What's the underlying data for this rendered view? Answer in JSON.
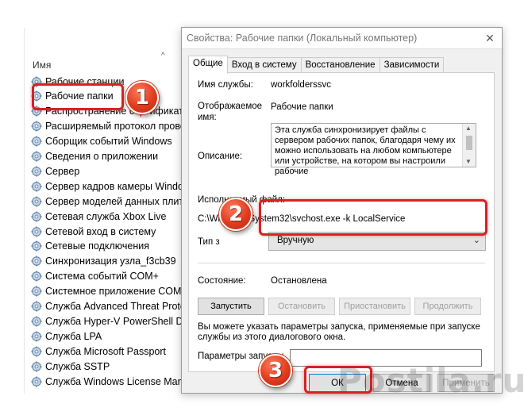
{
  "services_list": {
    "column_header": "Имя",
    "items": [
      "Рабочие станции",
      "Рабочие папки",
      "Распространение сертификата",
      "Расширяемый протокол прове",
      "Сборщик событий Windows",
      "Сведения о приложении",
      "Сервер",
      "Сервер кадров камеры Window",
      "Сервер моделей данных плитки",
      "Сетевая служба Xbox Live",
      "Сетевой вход в систему",
      "Сетевые подключения",
      "Синхронизация узла_f3cb39",
      "Система событий COM+",
      "Системное приложение COM+",
      "Служба Advanced Threat Protec",
      "Служба Hyper-V PowerShell Dire",
      "Служба LPA",
      "Служба Microsoft Passport",
      "Служба SSTP",
      "Служба Windows License Mana"
    ]
  },
  "dialog": {
    "title": "Свойства: Рабочие папки (Локальный компьютер)",
    "close_glyph": "✕",
    "tabs": [
      "Общие",
      "Вход в систему",
      "Восстановление",
      "Зависимости"
    ],
    "service_name_label": "Имя службы:",
    "service_name_value": "workfolderssvc",
    "display_name_label": "Отображаемое имя:",
    "display_name_value": "Рабочие папки",
    "description_label": "Описание:",
    "description_text": "Эта служба синхронизирует файлы с сервером рабочих папок, благодаря чему их можно использовать на любом компьютере или устройстве, на котором вы настроили рабочие",
    "exe_label": "Исполняемый файл:",
    "exe_value": "C:\\Windows\\System32\\svchost.exe -k LocalService",
    "startup_type_label": "Тип з",
    "startup_type_value": "Вручную",
    "status_label": "Состояние:",
    "status_value": "Остановлена",
    "buttons": {
      "start": "Запустить",
      "stop": "Остановить",
      "pause": "Приостановить",
      "resume": "Продолжить"
    },
    "hint_text": "Вы можете указать параметры запуска, применяемые при запуске службы из этого диалогового окна.",
    "params_label": "Параметры запуска:",
    "params_value": "",
    "ok_label": "ОК",
    "cancel_label": "Отмена",
    "apply_label": "Применить"
  },
  "annotations": {
    "badge_1": "1",
    "badge_2": "2",
    "badge_3": "3",
    "highlight_color": "#d62222",
    "badge_color": "#e03c1e"
  },
  "watermark": "Postila.ru"
}
